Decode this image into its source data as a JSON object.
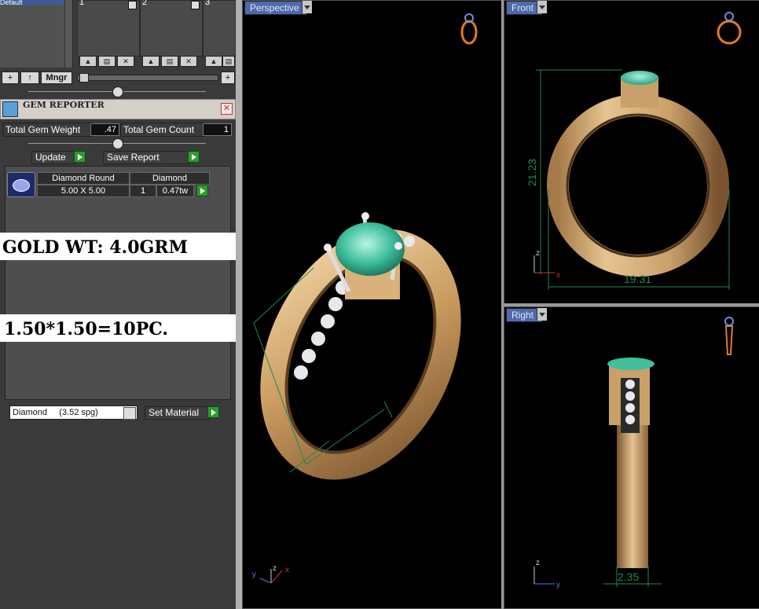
{
  "layers": {
    "selected_label": "Default",
    "slots": [
      "1",
      "2",
      "3"
    ],
    "add_label": "+",
    "up_label": "↑",
    "manager_label": "Mngr",
    "plus_label": "+"
  },
  "gem_reporter": {
    "title": "GEM REPORTER",
    "total_weight_label": "Total Gem Weight",
    "total_weight_value": ".47",
    "total_count_label": "Total Gem Count",
    "total_count_value": "1",
    "update_label": "Update",
    "save_report_label": "Save Report",
    "table": {
      "headers": [
        "Diamond Round",
        "Diamond"
      ],
      "row": {
        "size": "5.00 X 5.00",
        "qty": "1",
        "weight": "0.47tw"
      }
    },
    "notes": [
      "GOLD WT: 4.0GRM",
      "1.50*1.50=10PC."
    ],
    "material_select": "Diamond     (3.52 spg)",
    "set_material_label": "Set Material"
  },
  "viewports": {
    "perspective": {
      "label": "Perspective"
    },
    "front": {
      "label": "Front",
      "dim_height": "21.23",
      "dim_width": "19.31"
    },
    "right": {
      "label": "Right",
      "dim_width": "2.35"
    }
  },
  "axes": {
    "x": "x",
    "y": "y",
    "z": "z"
  },
  "colors": {
    "panel": "#3a3a3a",
    "viewport_label": "#4e6aa8",
    "go_button": "#2c9c2c",
    "dimension": "#1f8a4c",
    "gold": "#c9a06a",
    "gem": "#46c9a8"
  },
  "icons": [
    "add-icon",
    "up-arrow-icon",
    "close-icon",
    "gem-reporter-icon",
    "play-icon",
    "ring-icon"
  ]
}
